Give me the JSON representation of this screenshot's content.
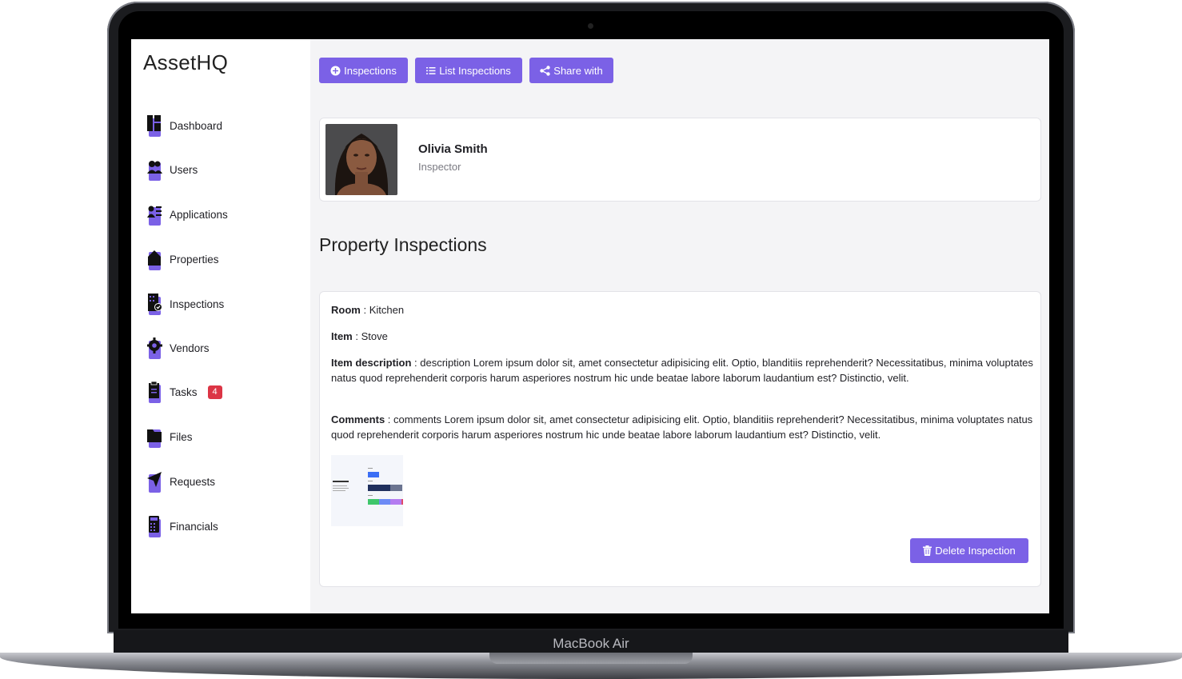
{
  "device": {
    "brand": "MacBook Air"
  },
  "app": {
    "name": "AssetHQ",
    "accent": "#7b61e6"
  },
  "sidebar": {
    "items": [
      {
        "label": "Dashboard",
        "icon": "dashboard-icon"
      },
      {
        "label": "Users",
        "icon": "users-icon"
      },
      {
        "label": "Applications",
        "icon": "applications-icon"
      },
      {
        "label": "Properties",
        "icon": "house-icon"
      },
      {
        "label": "Inspections",
        "icon": "building-check-icon"
      },
      {
        "label": "Vendors",
        "icon": "gear-icon"
      },
      {
        "label": "Tasks",
        "icon": "clipboard-icon",
        "badge": "4"
      },
      {
        "label": "Files",
        "icon": "folder-icon"
      },
      {
        "label": "Requests",
        "icon": "paper-plane-icon"
      },
      {
        "label": "Financials",
        "icon": "calculator-icon"
      }
    ]
  },
  "toolbar": {
    "inspections_label": "Inspections",
    "list_inspections_label": "List Inspections",
    "share_label": "Share with"
  },
  "profile": {
    "name": "Olivia Smith",
    "role": "Inspector"
  },
  "main": {
    "title": "Property Inspections"
  },
  "inspection": {
    "room_label": "Room",
    "room_value": "Kitchen",
    "item_label": "Item",
    "item_value": "Stove",
    "description_label": "Item description",
    "description_value": "description Lorem ipsum dolor sit, amet consectetur adipisicing elit. Optio, blanditiis reprehenderit? Necessitatibus, minima voluptates natus quod reprehenderit corporis harum asperiores nostrum hic unde beatae labore laborum laudantium est? Distinctio, velit.",
    "comments_label": "Comments",
    "comments_value": "comments Lorem ipsum dolor sit, amet consectetur adipisicing elit. Optio, blanditiis reprehenderit? Necessitatibus, minima voluptates natus quod reprehenderit corporis harum asperiores nostrum hic unde beatae labore laborum laudantium est? Distinctio, velit.",
    "delete_label": "Delete Inspection"
  }
}
